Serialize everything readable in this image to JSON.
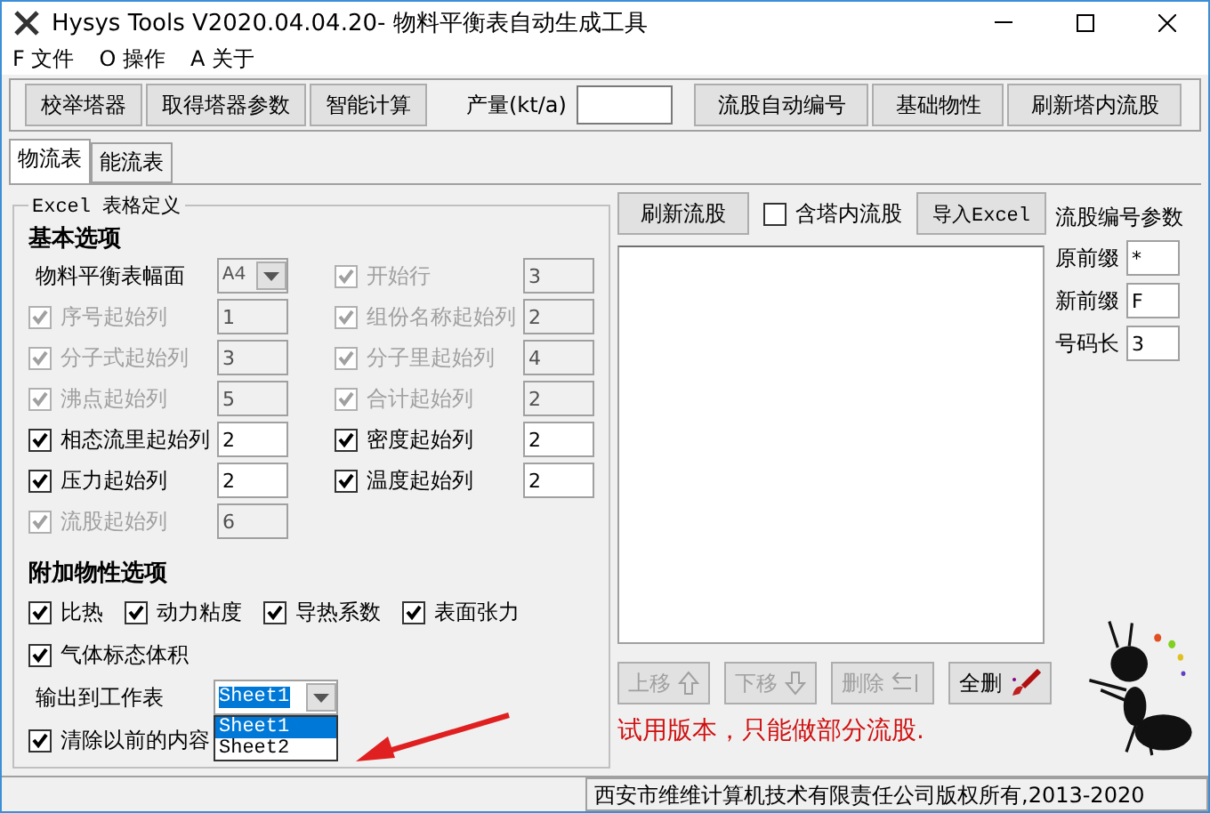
{
  "window": {
    "title": "Hysys Tools V2020.04.04.20- 物料平衡表自动生成工具"
  },
  "menu": [
    {
      "label": "F 文件"
    },
    {
      "label": "O 操作"
    },
    {
      "label": "A 关于"
    }
  ],
  "toolbar": [
    {
      "kind": "button",
      "label": "校举塔器"
    },
    {
      "kind": "button",
      "label": "取得塔器参数"
    },
    {
      "kind": "button",
      "label": "智能计算"
    },
    {
      "kind": "field",
      "label": "产量(kt/a)"
    },
    {
      "kind": "button",
      "label": "流股自动编号"
    },
    {
      "kind": "button",
      "label": "基础物性"
    },
    {
      "kind": "button",
      "label": "刷新塔内流股"
    }
  ],
  "tabs": [
    {
      "label": "物流表",
      "selected": true
    },
    {
      "label": "能流表",
      "selected": false
    }
  ],
  "excel_group": {
    "title": "Excel 表格定义",
    "basic_heading": "基本选项",
    "page_size": {
      "label": "物料平衡表幅面",
      "value": "A4"
    },
    "start_row": {
      "label": "开始行",
      "checked": true,
      "disabled": true,
      "value": "3"
    },
    "basic_options": [
      {
        "label": "序号起始列",
        "checked": true,
        "disabled": true,
        "value": "1"
      },
      {
        "label": "组份名称起始列",
        "checked": true,
        "disabled": true,
        "value": "2"
      },
      {
        "label": "分子式起始列",
        "checked": true,
        "disabled": true,
        "value": "3"
      },
      {
        "label": "分子里起始列",
        "checked": true,
        "disabled": true,
        "value": "4"
      },
      {
        "label": "沸点起始列",
        "checked": true,
        "disabled": true,
        "value": "5"
      },
      {
        "label": "合计起始列",
        "checked": true,
        "disabled": true,
        "value": "2"
      },
      {
        "label": "相态流里起始列",
        "checked": true,
        "disabled": false,
        "value": "2"
      },
      {
        "label": "密度起始列",
        "checked": true,
        "disabled": false,
        "value": "2"
      },
      {
        "label": "压力起始列",
        "checked": true,
        "disabled": false,
        "value": "2"
      },
      {
        "label": "温度起始列",
        "checked": true,
        "disabled": false,
        "value": "2"
      },
      {
        "label": "流股起始列",
        "checked": true,
        "disabled": true,
        "value": "6"
      }
    ],
    "extra_heading": "附加物性选项",
    "extra_options": [
      {
        "label": "比热",
        "checked": true
      },
      {
        "label": "动力粘度",
        "checked": true
      },
      {
        "label": "导热系数",
        "checked": true
      },
      {
        "label": "表面张力",
        "checked": true
      },
      {
        "label": "气体标态体积",
        "checked": true
      }
    ],
    "output_sheet": {
      "label": "输出到工作表",
      "value": "Sheet1",
      "options": [
        {
          "label": "Sheet1",
          "selected": true
        },
        {
          "label": "Sheet2",
          "selected": false
        }
      ]
    },
    "clear_previous": {
      "label": "清除以前的内容",
      "checked": true
    }
  },
  "streams": {
    "refresh_button": "刷新流股",
    "include_tower": {
      "label": "含塔内流股",
      "checked": false
    },
    "import_button": "导入Excel",
    "move_buttons": [
      {
        "label": "上移",
        "disabled": true
      },
      {
        "label": "下移",
        "disabled": true
      },
      {
        "label": "删除",
        "disabled": true
      },
      {
        "label": "全删",
        "disabled": false
      }
    ],
    "trial_notice": "试用版本，只能做部分流股."
  },
  "stream_params": {
    "title": "流股编号参数",
    "fields": [
      {
        "label": "原前缀",
        "value": "*"
      },
      {
        "label": "新前缀",
        "value": "F"
      },
      {
        "label": "号码长",
        "value": "3"
      }
    ]
  },
  "status_bar": "西安市维维计算机技术有限责任公司版权所有,2013-2020"
}
